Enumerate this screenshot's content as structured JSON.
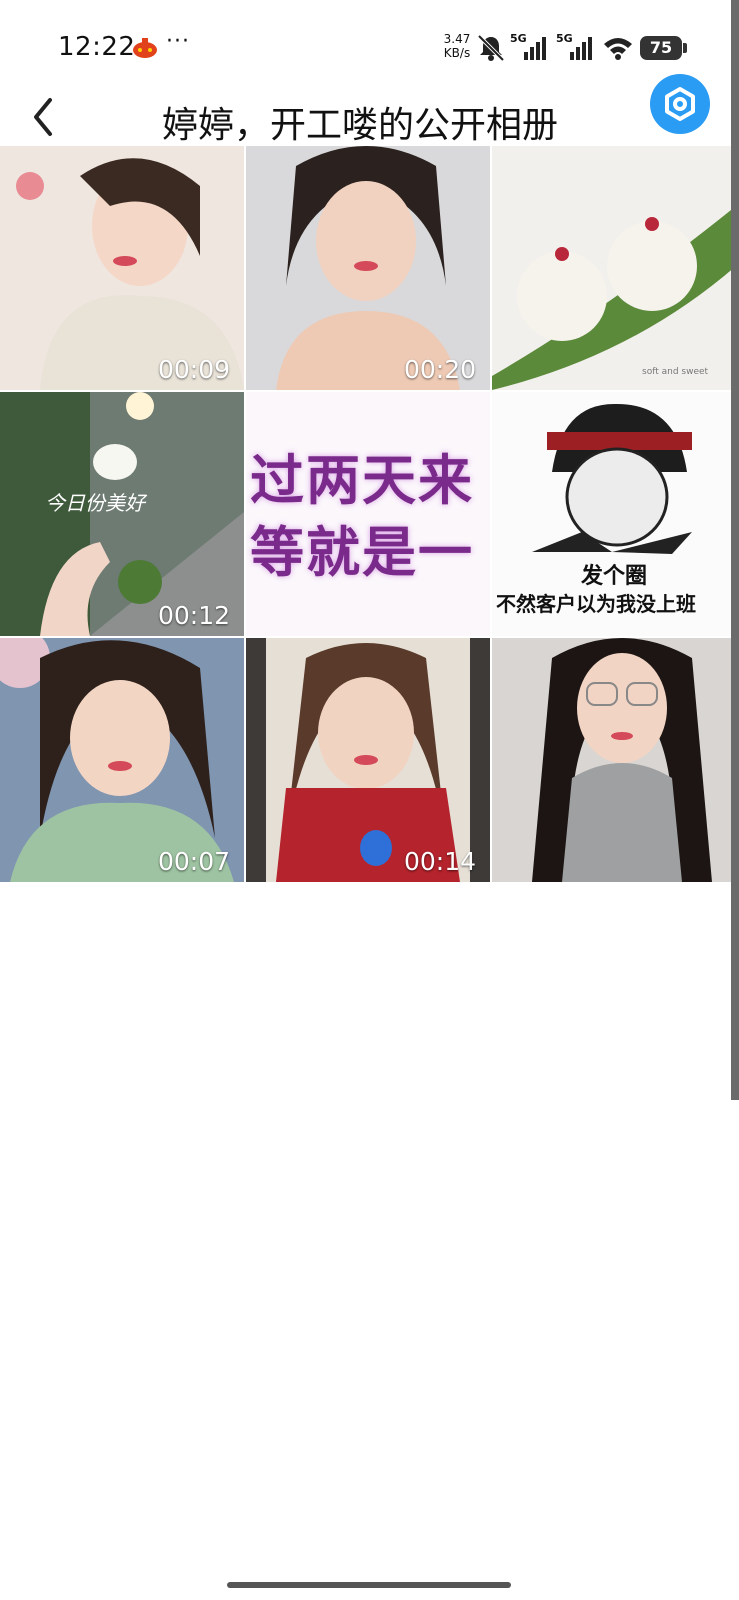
{
  "status_bar": {
    "time": "12:22",
    "more": "···",
    "net_speed_value": "3.47",
    "net_speed_unit": "KB/s",
    "signal1_tag": "5G",
    "signal2_tag": "5G",
    "battery": "75"
  },
  "header": {
    "title": "婷婷，开工喽的公开相册",
    "accent_color": "#2a9cf3"
  },
  "album": {
    "items": [
      {
        "kind": "video",
        "duration": "00:09"
      },
      {
        "kind": "video",
        "duration": "00:20"
      },
      {
        "kind": "photo",
        "caption": "soft and sweet"
      },
      {
        "kind": "video",
        "duration": "00:12",
        "overlay": "今日份美好"
      },
      {
        "kind": "photo",
        "line1": "过两天来",
        "line2": "等就是一"
      },
      {
        "kind": "photo",
        "cap1": "发个圈",
        "cap2": "不然客户以为我没上班"
      },
      {
        "kind": "video",
        "duration": "00:07"
      },
      {
        "kind": "video",
        "duration": "00:14"
      },
      {
        "kind": "photo"
      }
    ]
  }
}
